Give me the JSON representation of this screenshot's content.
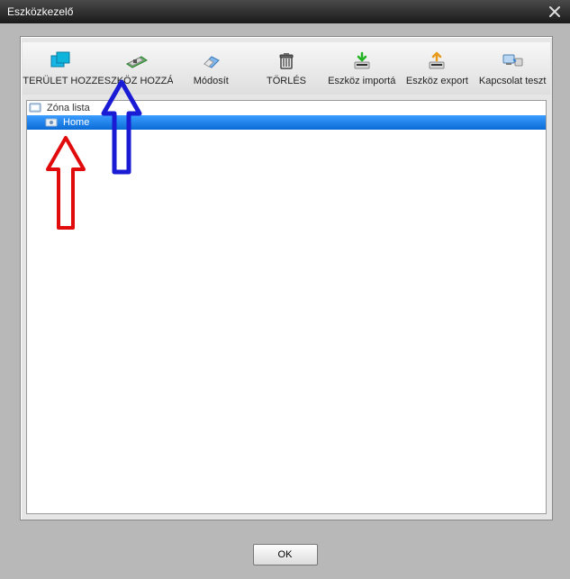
{
  "window": {
    "title": "Eszközkezelő"
  },
  "toolbar": {
    "area_add": "TERÜLET HOZZ",
    "device_add": "ESZKÖZ HOZZÁ",
    "modify": "Módosít",
    "delete": "TÖRLÉS",
    "import": "Eszköz importá",
    "export": "Eszköz export",
    "conn_test": "Kapcsolat teszt"
  },
  "tree": {
    "root": "Zóna lista",
    "child": "Home"
  },
  "buttons": {
    "ok": "OK"
  },
  "colors": {
    "selection": "#1e90ff",
    "arrow_blue": "#1a1bd4",
    "arrow_red": "#e10b0b"
  }
}
